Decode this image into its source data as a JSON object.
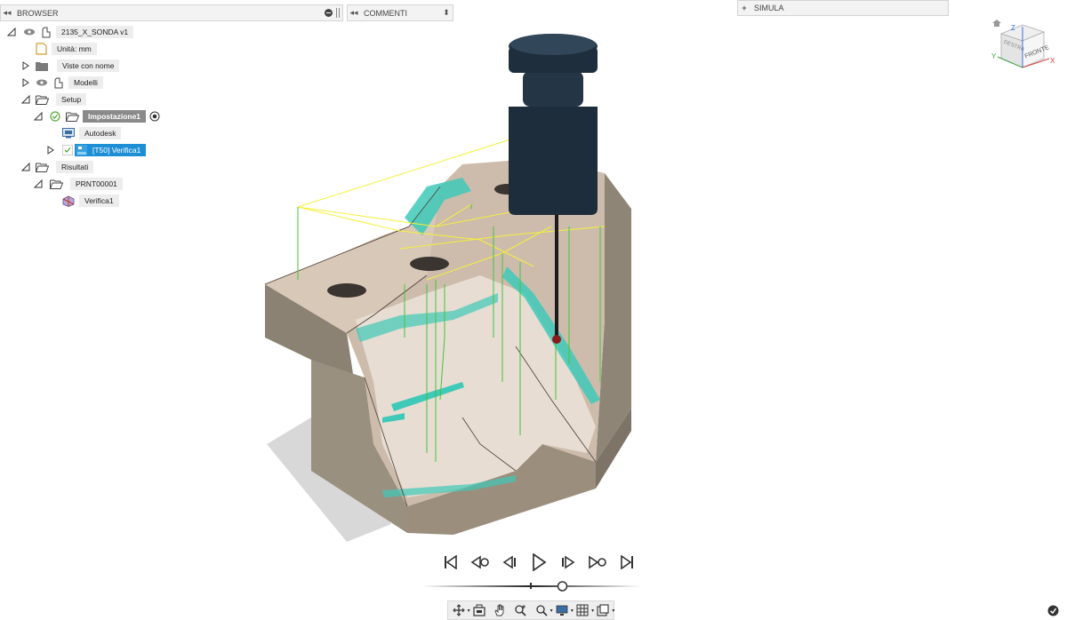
{
  "browser": {
    "collapse_glyph": "◂◂",
    "title": "BROWSER",
    "tree": [
      {
        "key": "doc",
        "label": "2135_X_SONDA v1"
      },
      {
        "key": "units",
        "label": "Unità: mm"
      },
      {
        "key": "named_views",
        "label": "Viste con nome"
      },
      {
        "key": "models",
        "label": "Modelli"
      },
      {
        "key": "setup",
        "label": "Setup"
      },
      {
        "key": "setup1",
        "label": "Impostazione1"
      },
      {
        "key": "autodesk",
        "label": "Autodesk"
      },
      {
        "key": "verify",
        "label": "[T50] Verifica1"
      },
      {
        "key": "results",
        "label": "Risultati"
      },
      {
        "key": "prnt",
        "label": "PRNT00001"
      },
      {
        "key": "verify_result",
        "label": "Verifica1"
      }
    ]
  },
  "comments": {
    "collapse_glyph": "◂◂",
    "title": "COMMENTI",
    "sort_glyph": "⬍"
  },
  "simula": {
    "expand_glyph": "+",
    "title": "SIMULA"
  },
  "viewcube": {
    "face_front": "FRONTE",
    "face_right": "DESTRA",
    "axis_x": "X",
    "axis_y": "Y",
    "axis_z": "Z"
  },
  "timeline": {
    "position_fraction": 0.65
  },
  "colors": {
    "accent_selected": "#1e8fd6",
    "model_face": "#c9b7a6",
    "model_side": "#8c8274",
    "probe_tip": "#8b1a1a",
    "probe_body": "#1e2d3b",
    "toolpath_yellow": "#f4f03a",
    "toolpath_green": "#46c43a",
    "inspected_cyan": "#3ec9b8"
  },
  "icons": {
    "playback": [
      "skip-to-start-icon",
      "previous-keyframe-icon",
      "step-back-icon",
      "play-icon",
      "step-forward-icon",
      "next-keyframe-icon",
      "skip-to-end-icon"
    ],
    "toolbar": [
      "orbit-icon",
      "look-at-icon",
      "pan-icon",
      "zoom-icon",
      "zoom-window-icon",
      "display-settings-icon",
      "grid-settings-icon",
      "viewports-icon"
    ]
  }
}
